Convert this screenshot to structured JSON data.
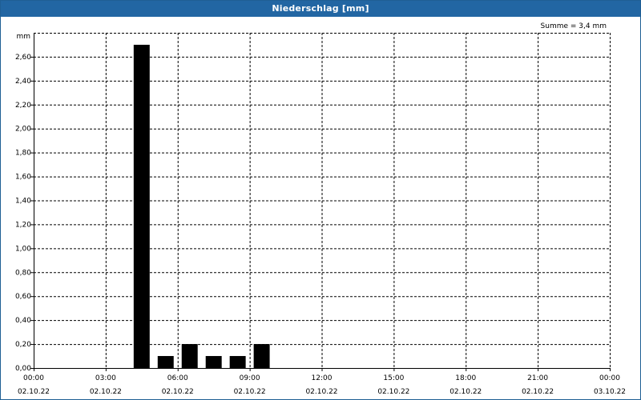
{
  "window": {
    "title": "Niederschlag [mm]"
  },
  "chart_data": {
    "type": "bar",
    "title": "Niederschlag [mm]",
    "annotation": "Summe = 3,4 mm",
    "ylabel": "mm",
    "ylim": [
      0,
      2.8
    ],
    "yticks": [
      0,
      0.2,
      0.4,
      0.6,
      0.8,
      1.0,
      1.2,
      1.4,
      1.6,
      1.8,
      2.0,
      2.2,
      2.4,
      2.6
    ],
    "ytick_labels": [
      "0,00",
      "0,20",
      "0,40",
      "0,60",
      "0,80",
      "1,00",
      "1,20",
      "1,40",
      "1,60",
      "1,80",
      "2,00",
      "2,20",
      "2,40",
      "2,60"
    ],
    "xlim_hours": [
      0,
      24
    ],
    "xticks": [
      {
        "time": "00:00",
        "date": "02.10.22"
      },
      {
        "time": "03:00",
        "date": "02.10.22"
      },
      {
        "time": "06:00",
        "date": "02.10.22"
      },
      {
        "time": "09:00",
        "date": "02.10.22"
      },
      {
        "time": "12:00",
        "date": "02.10.22"
      },
      {
        "time": "15:00",
        "date": "02.10.22"
      },
      {
        "time": "18:00",
        "date": "02.10.22"
      },
      {
        "time": "21:00",
        "date": "02.10.22"
      },
      {
        "time": "00:00",
        "date": "03.10.22"
      }
    ],
    "bars": [
      {
        "start": "04:00",
        "end": "05:00",
        "value": 2.7
      },
      {
        "start": "05:00",
        "end": "06:00",
        "value": 0.1
      },
      {
        "start": "06:00",
        "end": "07:00",
        "value": 0.2
      },
      {
        "start": "07:00",
        "end": "08:00",
        "value": 0.1
      },
      {
        "start": "08:00",
        "end": "09:00",
        "value": 0.1
      },
      {
        "start": "09:00",
        "end": "10:00",
        "value": 0.2
      }
    ],
    "bar_color": "#000000",
    "grid": true,
    "grid_style": "dashed"
  }
}
